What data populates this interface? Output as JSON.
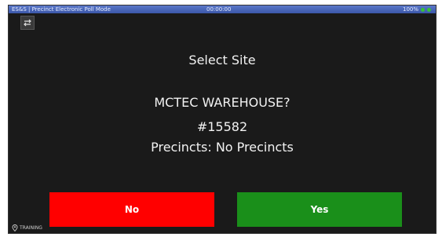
{
  "status_bar": {
    "left_text": "ES&S | Precinct Electronic Poll Mode",
    "center_text": "00:00:00",
    "right_text": "100%"
  },
  "icons": {
    "menu": "arrows-menu-icon",
    "location": "location-pin-icon",
    "status": "status-dot-icon"
  },
  "dialog": {
    "title": "Select Site",
    "site_name": "MCTEC WAREHOUSE?",
    "site_id": "#15582",
    "precincts": "Precincts: No Precincts"
  },
  "buttons": {
    "no_label": "No",
    "yes_label": "Yes"
  },
  "footer": {
    "location_label": "TRAINING"
  },
  "colors": {
    "background": "#1a1a1a",
    "no_button": "#ff0000",
    "yes_button": "#1a8f1a",
    "status_bar": "#4a67b8"
  }
}
